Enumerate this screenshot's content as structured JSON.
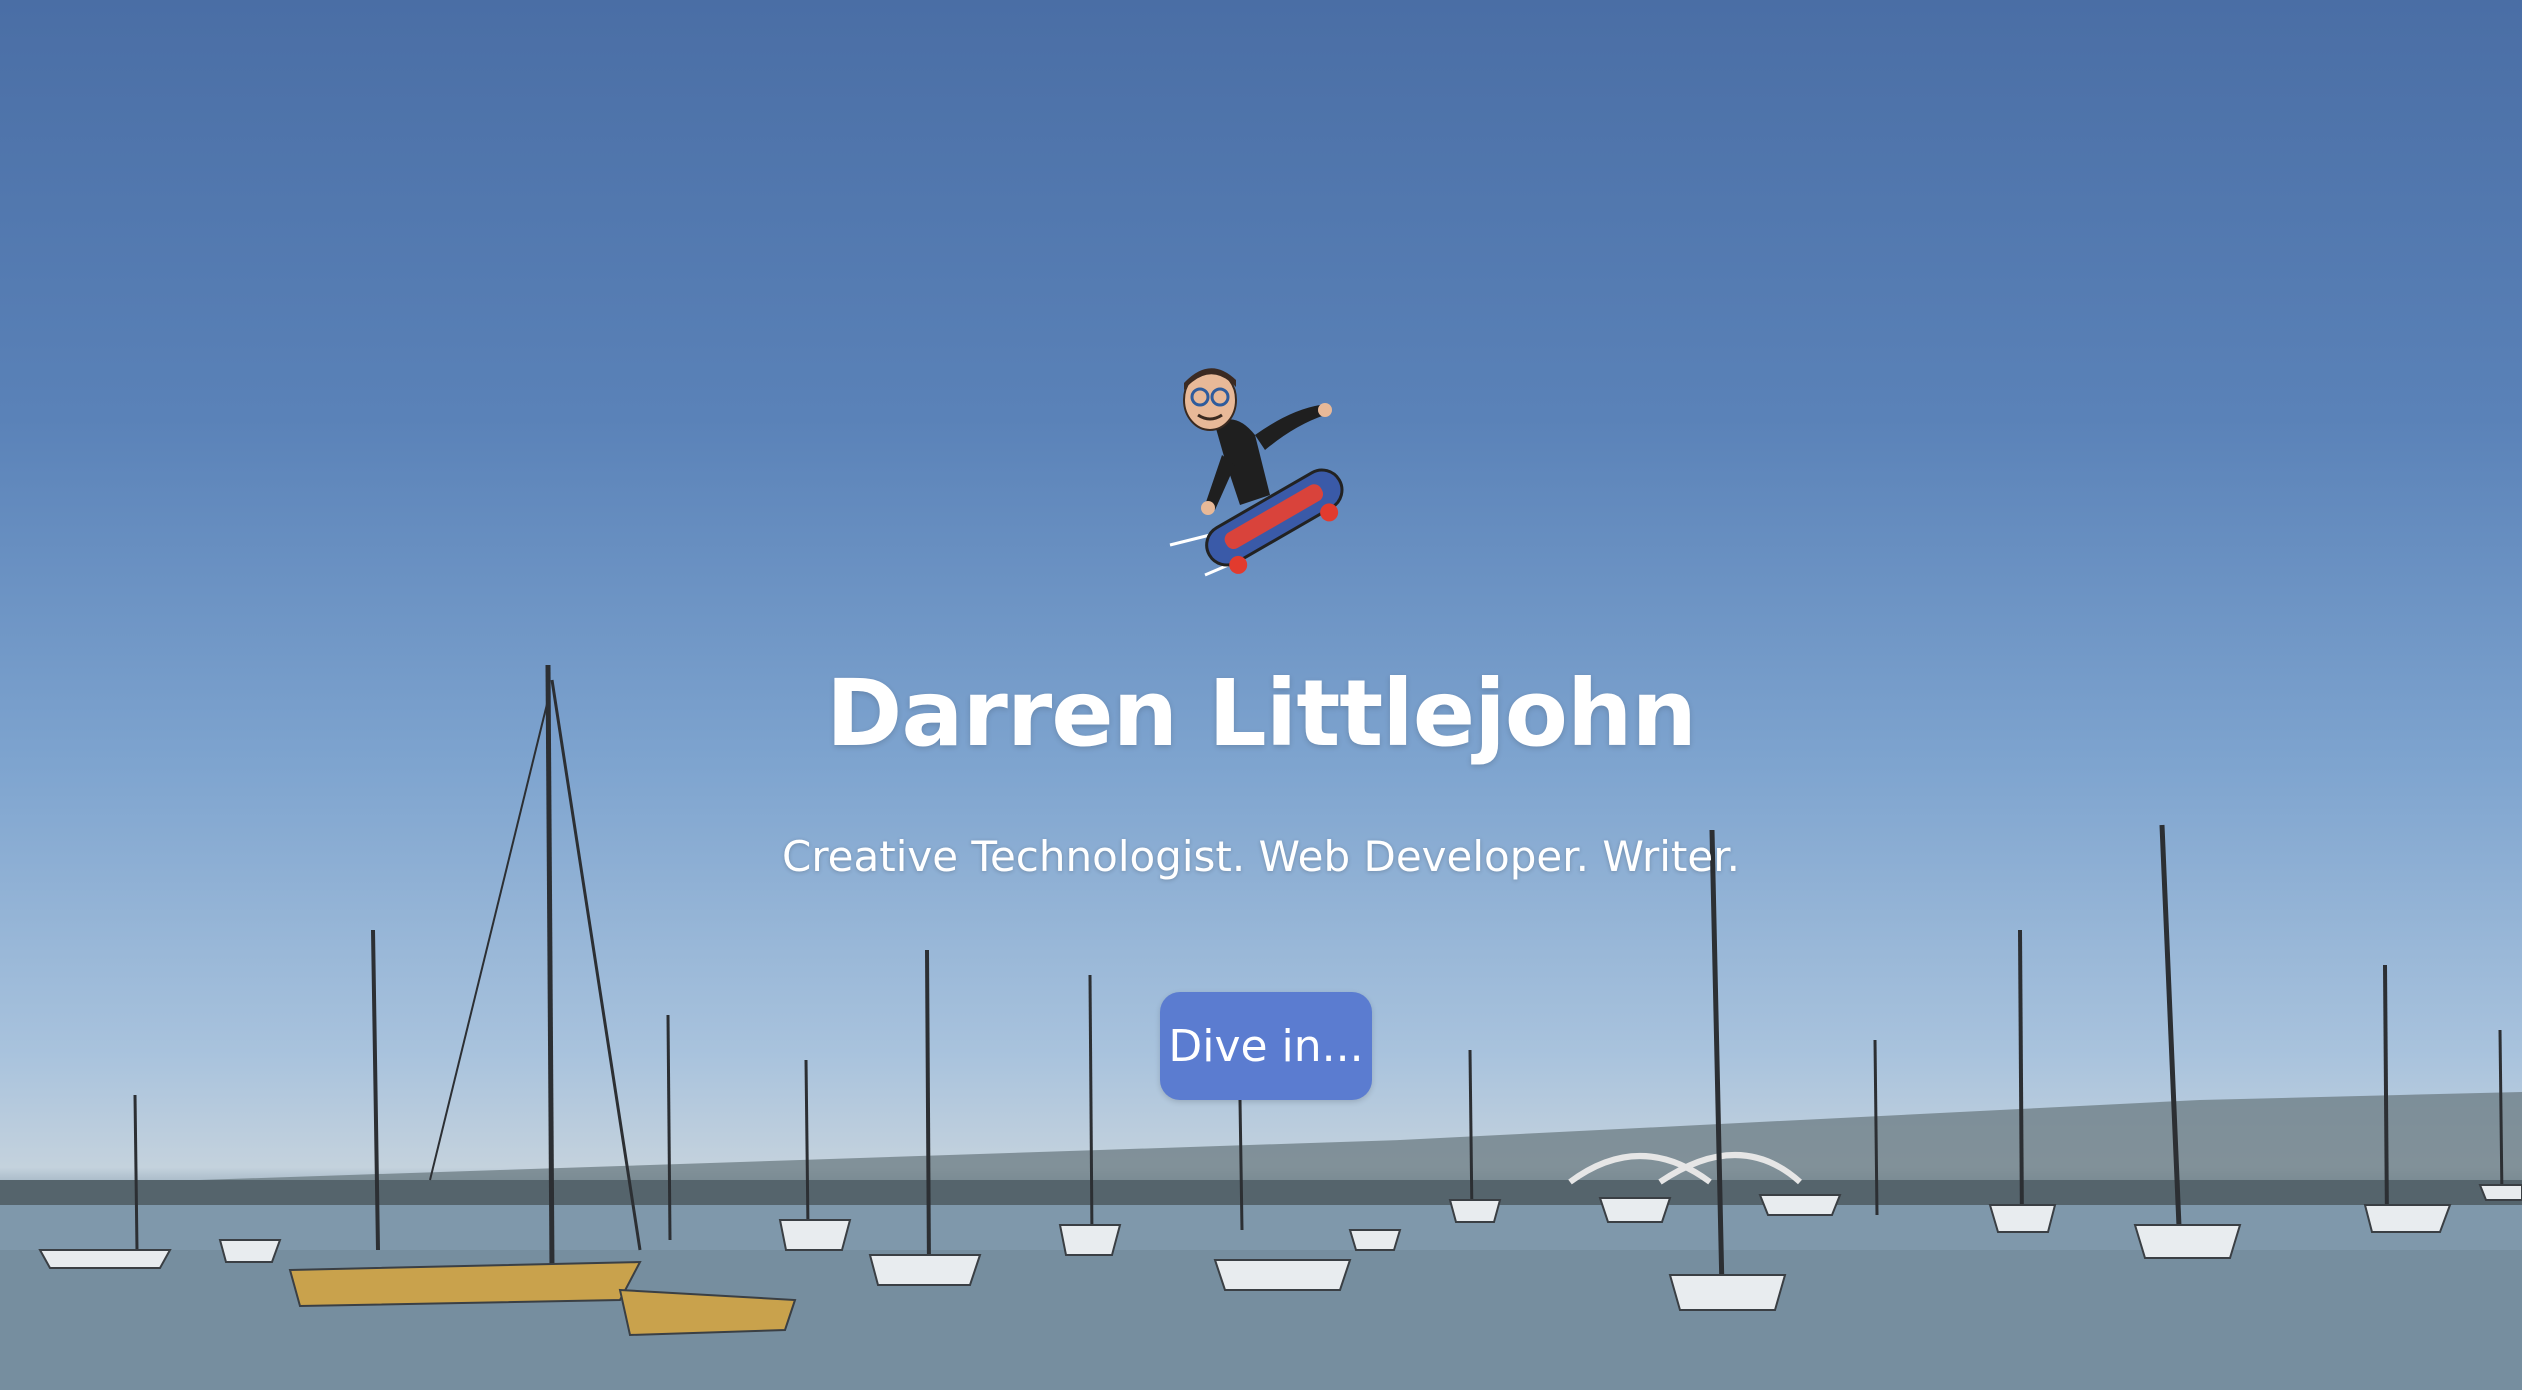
{
  "hero": {
    "name": "Darren Littlejohn",
    "tagline": "Creative Technologist. Web Developer. Writer.",
    "cta_label": "Dive in...",
    "avatar_icon": "skateboarding-avatar-icon",
    "background": "harbor-sailboats-image"
  },
  "colors": {
    "sky_top": "#4a6ea5",
    "sky_horizon": "#a9c3dd",
    "water": "#7f98ab",
    "button": "#5b7cd0",
    "text": "#ffffff"
  }
}
